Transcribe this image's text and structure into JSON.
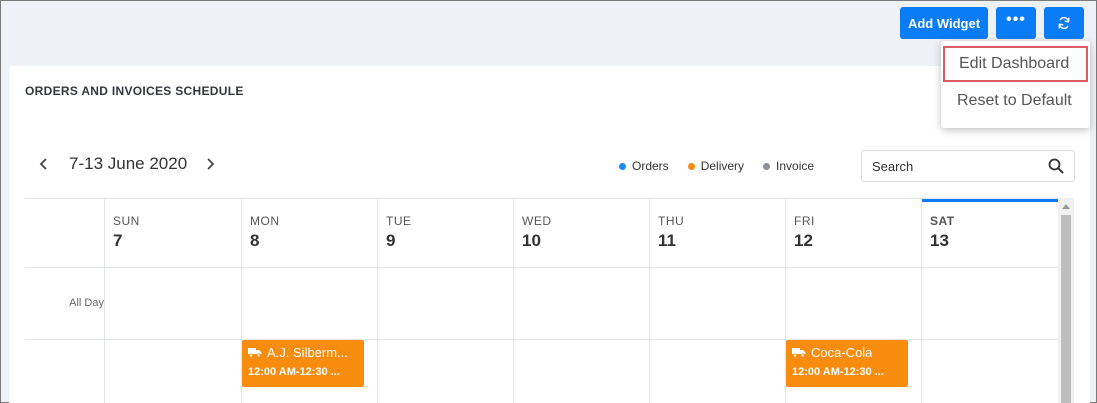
{
  "toolbar": {
    "add_widget_label": "Add Widget",
    "more_label": "•••"
  },
  "menu": {
    "items": [
      "Edit Dashboard",
      "Reset to Default"
    ]
  },
  "widget": {
    "title": "ORDERS AND INVOICES SCHEDULE",
    "date_range": "7-13 June 2020",
    "legend": [
      {
        "label": "Orders",
        "color": "#1a8cf0"
      },
      {
        "label": "Delivery",
        "color": "#f78c0f"
      },
      {
        "label": "Invoice",
        "color": "#8a8f96"
      }
    ],
    "search": {
      "placeholder": "Search"
    },
    "days": [
      {
        "name": "SUN",
        "num": "7"
      },
      {
        "name": "MON",
        "num": "8"
      },
      {
        "name": "TUE",
        "num": "9"
      },
      {
        "name": "WED",
        "num": "10"
      },
      {
        "name": "THU",
        "num": "11"
      },
      {
        "name": "FRI",
        "num": "12"
      },
      {
        "name": "SAT",
        "num": "13"
      }
    ],
    "all_day_label": "All Day",
    "events": [
      {
        "title": "A.J. Silberm...",
        "time": "12:00 AM-12:30 ...",
        "day": "MON"
      },
      {
        "title": "Coca-Cola",
        "time": "12:00 AM-12:30 ...",
        "day": "FRI"
      }
    ]
  },
  "colors": {
    "accent": "#0a7cf5",
    "delivery": "#f78c0f",
    "highlight_border": "#e05a63"
  }
}
